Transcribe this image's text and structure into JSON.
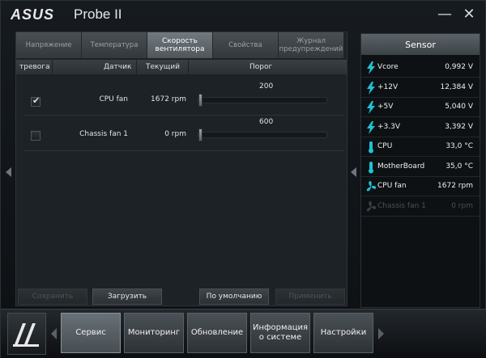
{
  "title": {
    "brand": "ASUS",
    "app_name": "Probe II"
  },
  "window_controls": {
    "minimize": "—",
    "close": "✕"
  },
  "tabs": [
    {
      "label": "Напряжение",
      "active": false
    },
    {
      "label": "Температура",
      "active": false
    },
    {
      "label": "Скорость вентилятора",
      "active": true
    },
    {
      "label": "Свойства",
      "active": false
    },
    {
      "label": "Журнал предупреждений",
      "active": false
    }
  ],
  "columns": {
    "alarm": "тревога",
    "sensor": "Датчик",
    "current": "Текущий",
    "threshold": "Порог"
  },
  "fans": [
    {
      "checked": true,
      "check_mark": "✔",
      "name": "CPU fan",
      "speed": "1672 rpm",
      "threshold": "200",
      "threshold_level": 0.0
    },
    {
      "checked": false,
      "check_mark": "",
      "name": "Chassis fan 1",
      "speed": "0 rpm",
      "threshold": "600",
      "threshold_level": 0.0
    }
  ],
  "buttons": {
    "save": "Сохранить",
    "load": "Загрузить",
    "default": "По умолчанию",
    "apply": "Применить"
  },
  "sensor_panel": {
    "header": "Sensor",
    "items": [
      {
        "icon": "voltage-icon",
        "label": "Vcore",
        "value": "0,992 V",
        "dim": false
      },
      {
        "icon": "voltage-icon",
        "label": "+12V",
        "value": "12,384 V",
        "dim": false
      },
      {
        "icon": "voltage-icon",
        "label": "+5V",
        "value": "5,040 V",
        "dim": false
      },
      {
        "icon": "voltage-icon",
        "label": "+3.3V",
        "value": "3,392 V",
        "dim": false
      },
      {
        "icon": "thermometer-icon",
        "label": "CPU",
        "value": "33,0 °C",
        "dim": false
      },
      {
        "icon": "thermometer-icon",
        "label": "MotherBoard",
        "value": "35,0 °C",
        "dim": false
      },
      {
        "icon": "fan-icon",
        "label": "CPU fan",
        "value": "1672 rpm",
        "dim": false
      },
      {
        "icon": "fan-icon",
        "label": "Chassis fan 1",
        "value": "0 rpm",
        "dim": true
      }
    ]
  },
  "nav": [
    {
      "label": "Сервис",
      "active": true
    },
    {
      "label": "Мониторинг",
      "active": false
    },
    {
      "label": "Обновление",
      "active": false
    },
    {
      "label": "Информация о системе",
      "active": false
    },
    {
      "label": "Настройки",
      "active": false
    }
  ],
  "colors": {
    "accent_cyan": "#1fc3d6",
    "panel_bg": "#1d2226",
    "sensor_bg": "#0e1113"
  }
}
